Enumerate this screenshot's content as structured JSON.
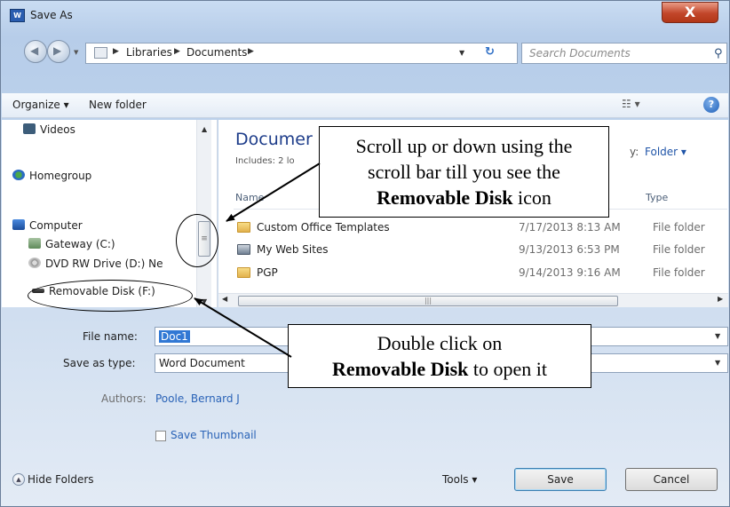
{
  "window": {
    "title": "Save As",
    "app_icon": "word-icon",
    "close_label": "X"
  },
  "address_bar": {
    "crumbs": [
      "Libraries",
      "Documents"
    ],
    "search_placeholder": "Search Documents"
  },
  "toolbar": {
    "organize_label": "Organize ▾",
    "new_folder_label": "New folder"
  },
  "nav_pane": {
    "items": [
      {
        "label": "Videos",
        "icon": "video-icon"
      },
      {
        "label": "Homegroup",
        "icon": "homegroup-icon"
      },
      {
        "label": "Computer",
        "icon": "computer-icon"
      },
      {
        "label": "Gateway (C:)",
        "icon": "drive-icon"
      },
      {
        "label": "DVD RW Drive (D:) Ne",
        "icon": "dvd-drive-icon"
      },
      {
        "label": "Removable Disk (F:)",
        "icon": "usb-drive-icon"
      }
    ]
  },
  "file_list": {
    "library_title": "Documer",
    "includes_text": "Includes: 2 lo",
    "arrange_label": "y:",
    "arrange_value": "Folder ▾",
    "columns": {
      "name": "Name",
      "type": "Type"
    },
    "rows": [
      {
        "name": "Custom Office Templates",
        "date": "7/17/2013 8:13 AM",
        "type": "File folder",
        "icon": "folder-icon"
      },
      {
        "name": "My Web Sites",
        "date": "9/13/2013 6:53 PM",
        "type": "File folder",
        "icon": "web-folder-icon"
      },
      {
        "name": "PGP",
        "date": "9/14/2013 9:16 AM",
        "type": "File folder",
        "icon": "folder-icon"
      }
    ]
  },
  "form": {
    "file_name_label": "File name:",
    "file_name_value": "Doc1",
    "save_as_type_label": "Save as type:",
    "save_as_type_value": "Word Document",
    "authors_label": "Authors:",
    "authors_value": "Poole, Bernard J",
    "save_thumbnail_label": "Save Thumbnail",
    "save_thumbnail_checked": false
  },
  "footer": {
    "hide_folders_label": "Hide Folders",
    "tools_label": "Tools",
    "save_label": "Save",
    "cancel_label": "Cancel"
  },
  "callouts": {
    "scroll": {
      "line1": "Scroll up or down using the",
      "line2": "scroll bar till you see the",
      "bold": "Removable Disk",
      "tail": " icon"
    },
    "double_click": {
      "line1": "Double click on",
      "bold": "Removable Disk",
      "tail": " to open it"
    }
  },
  "colors": {
    "title_accent": "#1e3d8a",
    "link": "#2a63b7",
    "selection": "#3178d4",
    "close": "#c2462a"
  }
}
